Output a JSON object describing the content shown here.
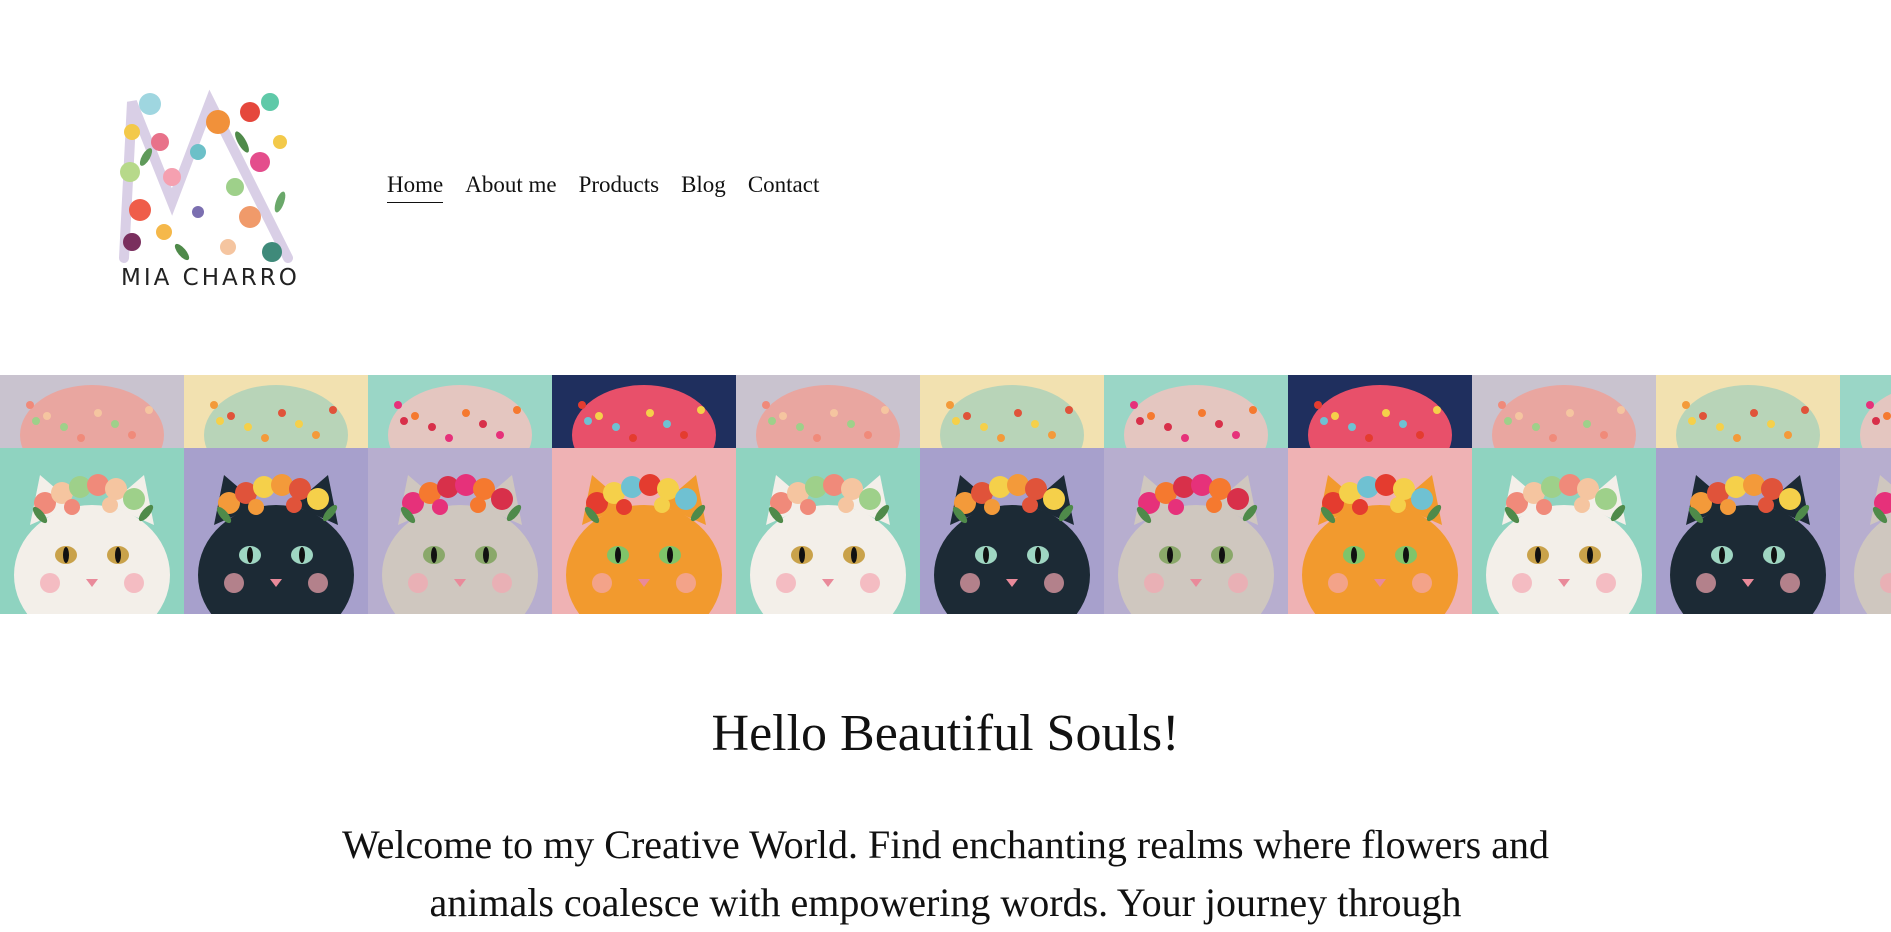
{
  "brand": {
    "name": "MIA CHARRO",
    "logo_icon": "floral-m-logo"
  },
  "nav": {
    "items": [
      {
        "label": "Home",
        "active": true
      },
      {
        "label": "About me",
        "active": false
      },
      {
        "label": "Products",
        "active": false
      },
      {
        "label": "Blog",
        "active": false
      },
      {
        "label": "Contact",
        "active": false
      }
    ]
  },
  "banner": {
    "tiles": [
      {
        "top_bg": "#c9c3cf",
        "top_fg": "#e9a6a0",
        "bot_bg": "#8fd3c0",
        "cat": "white",
        "flowers": [
          "#f08a7a",
          "#f5c5a0",
          "#9ed08a"
        ]
      },
      {
        "top_bg": "#f2e1b0",
        "top_fg": "#b8d4b8",
        "bot_bg": "#a7a0cc",
        "cat": "black",
        "flowers": [
          "#f39a3a",
          "#e0533a",
          "#f5d04a"
        ]
      },
      {
        "top_bg": "#9ad6c6",
        "top_fg": "#e4c6c0",
        "bot_bg": "#b7aecf",
        "cat": "grey",
        "flowers": [
          "#e6317a",
          "#f5792f",
          "#d8304a"
        ]
      },
      {
        "top_bg": "#1f2f5e",
        "top_fg": "#e8506a",
        "bot_bg": "#efb2b4",
        "cat": "orange",
        "flowers": [
          "#e43c2f",
          "#f5d04a",
          "#6fc1d2"
        ]
      },
      {
        "top_bg": "#c9c3cf",
        "top_fg": "#e9a6a0",
        "bot_bg": "#8fd3c0",
        "cat": "white",
        "flowers": [
          "#f08a7a",
          "#f5c5a0",
          "#9ed08a"
        ]
      },
      {
        "top_bg": "#f2e1b0",
        "top_fg": "#b8d4b8",
        "bot_bg": "#a7a0cc",
        "cat": "black",
        "flowers": [
          "#f39a3a",
          "#e0533a",
          "#f5d04a"
        ]
      },
      {
        "top_bg": "#9ad6c6",
        "top_fg": "#e4c6c0",
        "bot_bg": "#b7aecf",
        "cat": "grey",
        "flowers": [
          "#e6317a",
          "#f5792f",
          "#d8304a"
        ]
      },
      {
        "top_bg": "#1f2f5e",
        "top_fg": "#e8506a",
        "bot_bg": "#efb2b4",
        "cat": "orange",
        "flowers": [
          "#e43c2f",
          "#f5d04a",
          "#6fc1d2"
        ]
      },
      {
        "top_bg": "#c9c3cf",
        "top_fg": "#e9a6a0",
        "bot_bg": "#8fd3c0",
        "cat": "white",
        "flowers": [
          "#f08a7a",
          "#f5c5a0",
          "#9ed08a"
        ]
      },
      {
        "top_bg": "#f2e1b0",
        "top_fg": "#b8d4b8",
        "bot_bg": "#a7a0cc",
        "cat": "black",
        "flowers": [
          "#f39a3a",
          "#e0533a",
          "#f5d04a"
        ]
      },
      {
        "top_bg": "#9ad6c6",
        "top_fg": "#e4c6c0",
        "bot_bg": "#b7aecf",
        "cat": "grey",
        "flowers": [
          "#e6317a",
          "#f5792f",
          "#d8304a"
        ]
      }
    ]
  },
  "main": {
    "heading": "Hello Beautiful Souls!",
    "intro": "Welcome to my Creative World. Find enchanting realms where flowers and animals coalesce with empowering words. Your journey through"
  }
}
